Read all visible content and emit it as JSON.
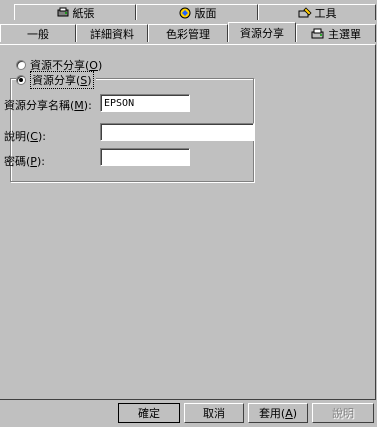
{
  "tabs_row1": [
    {
      "label": "紙張",
      "icon": "paper-icon"
    },
    {
      "label": "版面",
      "icon": "layout-icon"
    },
    {
      "label": "工具",
      "icon": "tools-icon"
    }
  ],
  "tabs_row2": [
    {
      "label": "一般"
    },
    {
      "label": "詳細資料"
    },
    {
      "label": "色彩管理"
    },
    {
      "label": "資源分享"
    },
    {
      "label": "主選單",
      "icon": "main-menu-icon"
    }
  ],
  "sharing": {
    "not_shared_label": "資源不分享(",
    "not_shared_key": "O",
    "shared_label": "資源分享(",
    "shared_key": "S",
    "close_paren": ")",
    "share_name_label": "資源分享名稱(",
    "share_name_key": "M",
    "share_name_suffix": "):",
    "share_name_value": "EPSON",
    "description_label": "說明(",
    "description_key": "C",
    "description_suffix": "):",
    "description_value": "",
    "password_label": "密碼(",
    "password_key": "P",
    "password_suffix": "):",
    "password_value": ""
  },
  "buttons": {
    "ok": "確定",
    "cancel": "取消",
    "apply_label": "套用(",
    "apply_key": "A",
    "apply_suffix": ")",
    "help": "說明"
  }
}
